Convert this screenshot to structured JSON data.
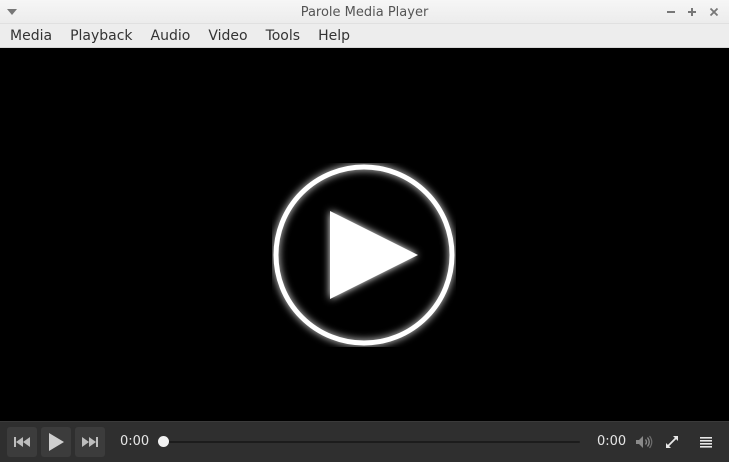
{
  "window": {
    "title": "Parole Media Player"
  },
  "menubar": {
    "items": [
      {
        "label": "Media"
      },
      {
        "label": "Playback"
      },
      {
        "label": "Audio"
      },
      {
        "label": "Video"
      },
      {
        "label": "Tools"
      },
      {
        "label": "Help"
      }
    ]
  },
  "controls": {
    "elapsed": "0:00",
    "duration": "0:00",
    "progress_fraction": 0
  },
  "icons": {
    "window_menu": "chevron-down-icon",
    "minimize": "minimize-icon",
    "maximize": "maximize-icon",
    "close": "close-icon",
    "big_play": "play-circle-icon",
    "previous": "skip-previous-icon",
    "play": "play-icon",
    "next": "skip-next-icon",
    "volume": "volume-icon",
    "fullscreen": "fullscreen-icon",
    "playlist": "playlist-icon"
  },
  "colors": {
    "titlebar": "#ececec",
    "menubar": "#ededed",
    "video_background": "#000000",
    "controlbar": "#2f2f2f",
    "control_text": "#e6e6e6"
  }
}
